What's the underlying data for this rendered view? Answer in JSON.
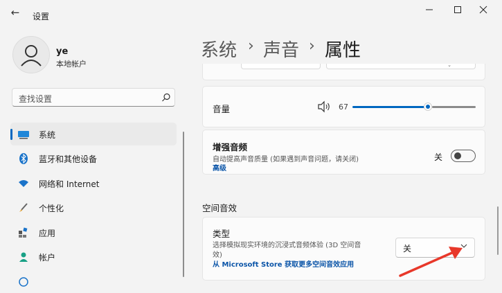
{
  "window": {
    "title": "设置",
    "back_icon": "back-arrow-icon",
    "controls": [
      "minimize-icon",
      "maximize-icon",
      "close-icon"
    ]
  },
  "profile": {
    "name": "ye",
    "account_type": "本地帐户"
  },
  "search": {
    "placeholder": "查找设置",
    "icon": "search-icon"
  },
  "nav": {
    "selected_index": 0,
    "items": [
      {
        "label": "系统",
        "icon": "monitor-icon"
      },
      {
        "label": "蓝牙和其他设备",
        "icon": "bluetooth-icon"
      },
      {
        "label": "网络和 Internet",
        "icon": "wifi-icon"
      },
      {
        "label": "个性化",
        "icon": "brush-icon"
      },
      {
        "label": "应用",
        "icon": "apps-icon"
      },
      {
        "label": "帐户",
        "icon": "person-icon"
      }
    ]
  },
  "breadcrumb": {
    "items": [
      "系统",
      "声音",
      "属性"
    ],
    "separator": "›"
  },
  "volume": {
    "label": "音量",
    "value": "67",
    "level": 67,
    "icon": "speaker-icon"
  },
  "enhance_audio": {
    "title": "增强音频",
    "description": "自动提高声音质量 (如果遇到声音问题，请关闭)",
    "link": "高级",
    "state_label": "关",
    "on": false
  },
  "spatial_sound": {
    "section_title": "空间音效",
    "type_title": "类型",
    "description_line1": "选择模拟现实环境的沉浸式音频体验 (3D 空间音",
    "description_line2": "效)",
    "store_link": "从 Microsoft Store 获取更多空间音效应用",
    "dropdown_value": "关"
  },
  "colors": {
    "accent": "#0067c0",
    "link": "#0b55a8",
    "annotation_arrow": "#e8382a"
  }
}
